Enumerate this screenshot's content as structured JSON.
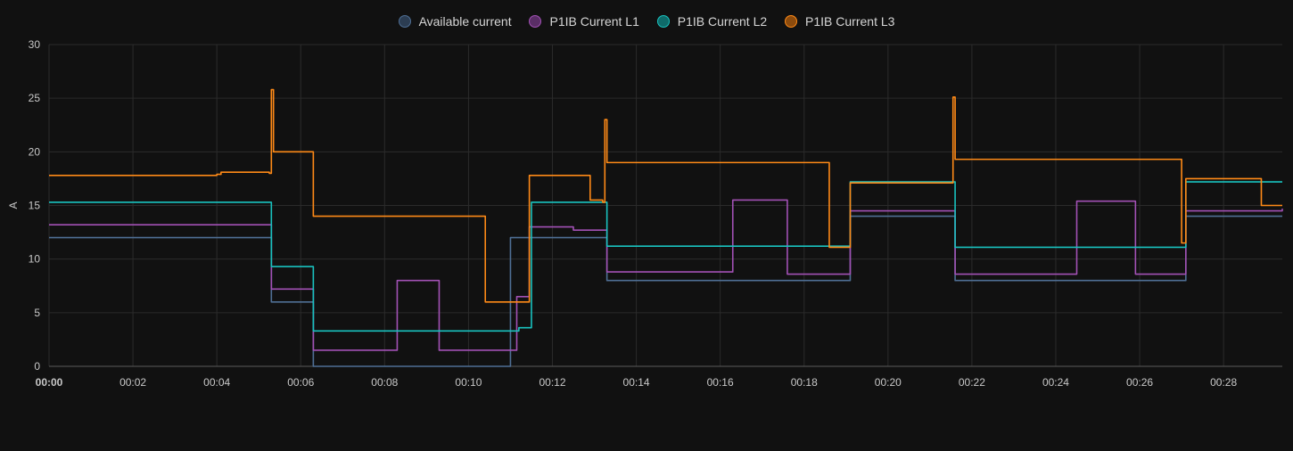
{
  "legend": [
    {
      "label": "Available current",
      "color": "#4f6f95"
    },
    {
      "label": "P1IB Current L1",
      "color": "#a251b5"
    },
    {
      "label": "P1IB Current L2",
      "color": "#19c2bf"
    },
    {
      "label": "P1IB Current L3",
      "color": "#ff8a17"
    }
  ],
  "chart_data": {
    "type": "line",
    "ylabel": "A",
    "xlabel": "",
    "ylim": [
      0,
      30
    ],
    "xlim": [
      0,
      29.4
    ],
    "yticks": [
      0,
      5,
      10,
      15,
      20,
      25,
      30
    ],
    "xticks": [
      "00:00",
      "00:02",
      "00:04",
      "00:06",
      "00:08",
      "00:10",
      "00:12",
      "00:14",
      "00:16",
      "00:18",
      "00:20",
      "00:22",
      "00:24",
      "00:26",
      "00:28"
    ],
    "grid": true,
    "legend_position": "top-center",
    "series": [
      {
        "name": "Available current",
        "color": "#4f6f95",
        "step": true,
        "points": [
          [
            0,
            12
          ],
          [
            5.3,
            6
          ],
          [
            6.3,
            0
          ],
          [
            11.0,
            12
          ],
          [
            13.3,
            8
          ],
          [
            19.1,
            14
          ],
          [
            21.6,
            8
          ],
          [
            27.1,
            14
          ],
          [
            29.4,
            14
          ]
        ]
      },
      {
        "name": "P1IB Current L1",
        "color": "#a251b5",
        "step": true,
        "points": [
          [
            0,
            13.2
          ],
          [
            5.3,
            7.2
          ],
          [
            6.3,
            1.5
          ],
          [
            8.3,
            8
          ],
          [
            9.3,
            1.5
          ],
          [
            11.15,
            6.5
          ],
          [
            11.45,
            13
          ],
          [
            12.5,
            12.7
          ],
          [
            13.3,
            8.8
          ],
          [
            16.3,
            15.5
          ],
          [
            17.6,
            8.6
          ],
          [
            19.1,
            14.5
          ],
          [
            21.6,
            8.6
          ],
          [
            24.5,
            15.4
          ],
          [
            25.9,
            8.6
          ],
          [
            27.1,
            14.5
          ],
          [
            29.4,
            14.7
          ]
        ]
      },
      {
        "name": "P1IB Current L2",
        "color": "#19c2bf",
        "step": true,
        "points": [
          [
            0,
            15.3
          ],
          [
            5.3,
            9.3
          ],
          [
            6.3,
            3.3
          ],
          [
            11.2,
            3.6
          ],
          [
            11.5,
            15.3
          ],
          [
            13.3,
            11.2
          ],
          [
            19.1,
            17.2
          ],
          [
            21.6,
            11.1
          ],
          [
            27.1,
            17.2
          ],
          [
            29.4,
            17.2
          ]
        ]
      },
      {
        "name": "P1IB Current L3",
        "color": "#ff8a17",
        "step": true,
        "points": [
          [
            0,
            17.8
          ],
          [
            4,
            17.9
          ],
          [
            4.1,
            18.1
          ],
          [
            5.25,
            18
          ],
          [
            5.3,
            25.8
          ],
          [
            5.35,
            20
          ],
          [
            6.3,
            14
          ],
          [
            10.4,
            6
          ],
          [
            11.45,
            17.8
          ],
          [
            12.0,
            17.8
          ],
          [
            12.9,
            15.5
          ],
          [
            13.2,
            15.3
          ],
          [
            13.25,
            23
          ],
          [
            13.3,
            19
          ],
          [
            18.6,
            11.1
          ],
          [
            19.1,
            17.1
          ],
          [
            21.55,
            25.1
          ],
          [
            21.6,
            19.3
          ],
          [
            27.0,
            11.5
          ],
          [
            27.1,
            17.5
          ],
          [
            28.9,
            15
          ],
          [
            29.4,
            15
          ]
        ]
      }
    ]
  }
}
